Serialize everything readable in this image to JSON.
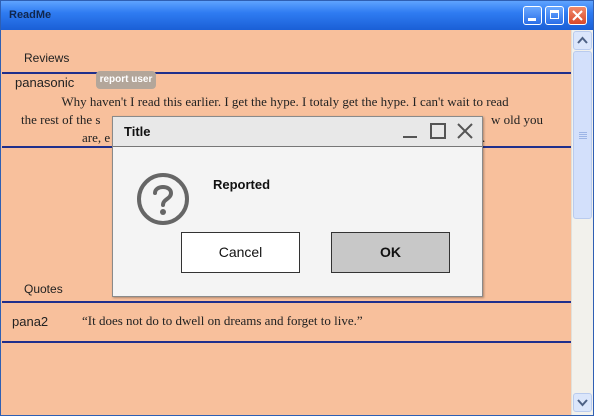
{
  "window": {
    "title": "ReadMe",
    "controls": [
      "minimize-icon",
      "maximize-icon",
      "close-icon"
    ]
  },
  "reviews": {
    "label": "Reviews",
    "items": [
      {
        "user": "panasonic",
        "report_label": "report user",
        "text_line1": "Why haven't I read this earlier. I get the hype. I totaly get the hype. I can't wait to read",
        "text_line2": "the rest of the s",
        "text_line2_end": "w old you",
        "text_line3": "are, e",
        "text_line3_end": "."
      }
    ]
  },
  "quotes": {
    "label": "Quotes",
    "items": [
      {
        "user": "pana2",
        "text": "“It does not do to dwell on dreams and forget to live.”"
      }
    ]
  },
  "dialog": {
    "title": "Title",
    "icon": "question-icon",
    "message": "Reported",
    "cancel_label": "Cancel",
    "ok_label": "OK"
  },
  "colors": {
    "background": "#f8c09c",
    "divider": "#1f2f8c",
    "titlebar": "#2f7cf2",
    "report_button": "#b3a69a",
    "ok_button": "#c8c8c8"
  }
}
